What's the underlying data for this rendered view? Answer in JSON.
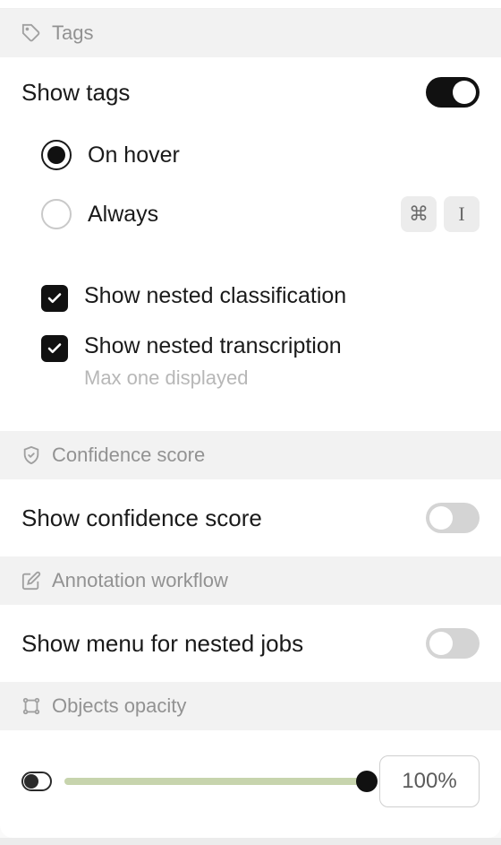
{
  "sections": {
    "tags": {
      "header": "Tags",
      "show_label": "Show tags",
      "show_on": true,
      "radio": {
        "selected": "on_hover",
        "on_hover": "On hover",
        "always": "Always"
      },
      "shortcut": {
        "mod": "⌘",
        "key": "I"
      },
      "nested_classification": {
        "label": "Show nested classification",
        "checked": true
      },
      "nested_transcription": {
        "label": "Show nested transcription",
        "sub": "Max one displayed",
        "checked": true
      }
    },
    "confidence": {
      "header": "Confidence score",
      "show_label": "Show confidence score",
      "show_on": false
    },
    "workflow": {
      "header": "Annotation workflow",
      "show_label": "Show menu for nested jobs",
      "show_on": false
    },
    "opacity": {
      "header": "Objects opacity",
      "percent": "100%",
      "value": 100
    }
  }
}
